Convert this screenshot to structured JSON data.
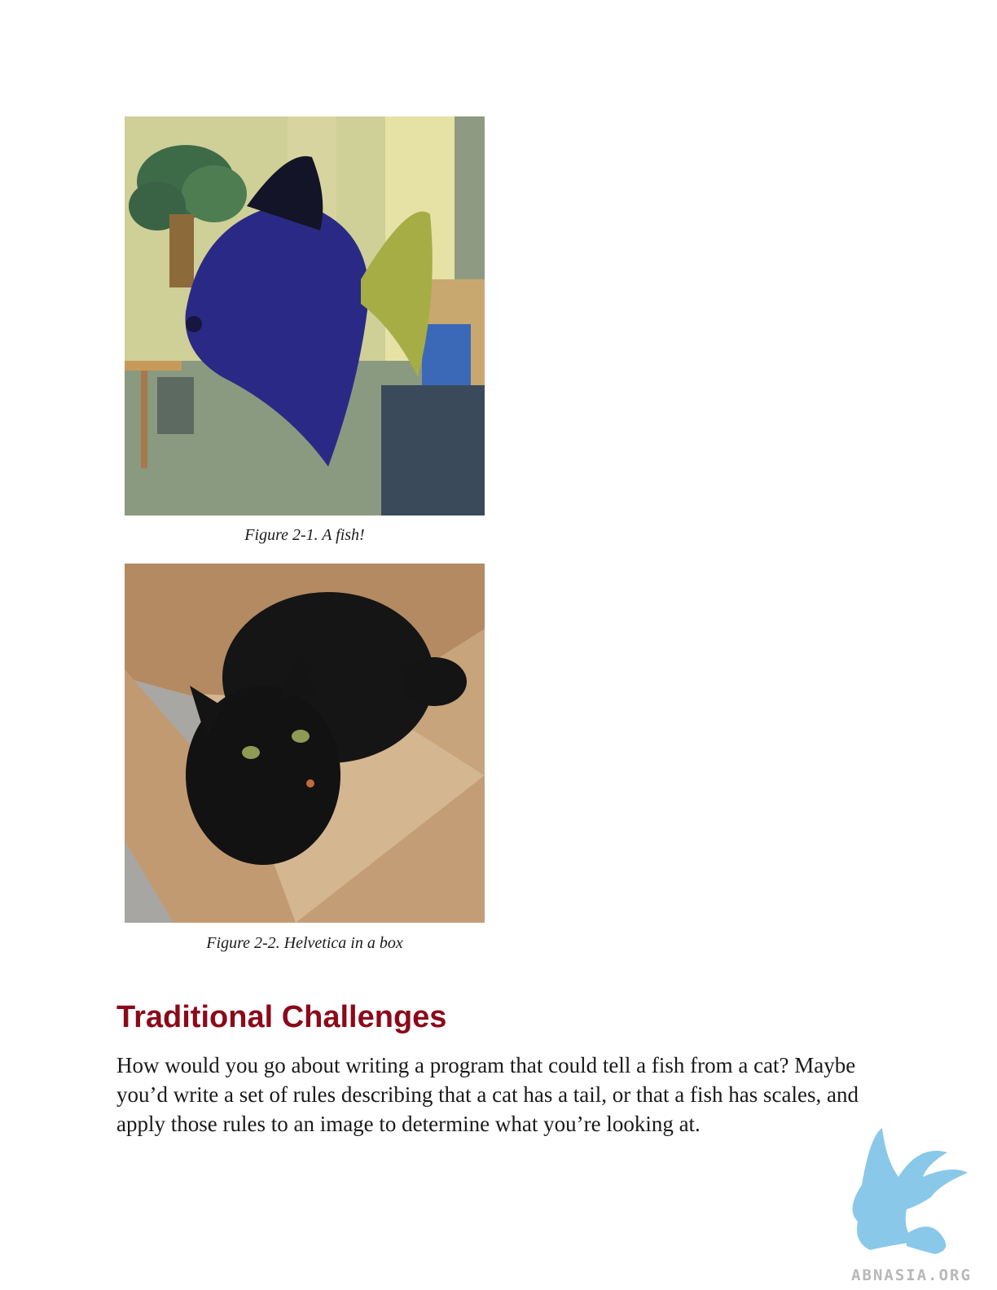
{
  "figures": [
    {
      "caption": "Figure 2-1. A fish!",
      "subject": "fish-photo"
    },
    {
      "caption": "Figure 2-2. Helvetica in a box",
      "subject": "cat-in-box-photo"
    }
  ],
  "section": {
    "heading": "Traditional Challenges",
    "paragraph": "How would you go about writing a program that could tell a fish from a cat? Maybe you’d write a set of rules describing that a cat has a tail, or that a fish has scales, and apply those rules to an image to determine what you’re looking at."
  },
  "watermark": {
    "text": "ABNASIA.ORG",
    "color": "#7ec3e8"
  },
  "colors": {
    "heading": "#8b0a1a",
    "text": "#1a1a1a"
  }
}
